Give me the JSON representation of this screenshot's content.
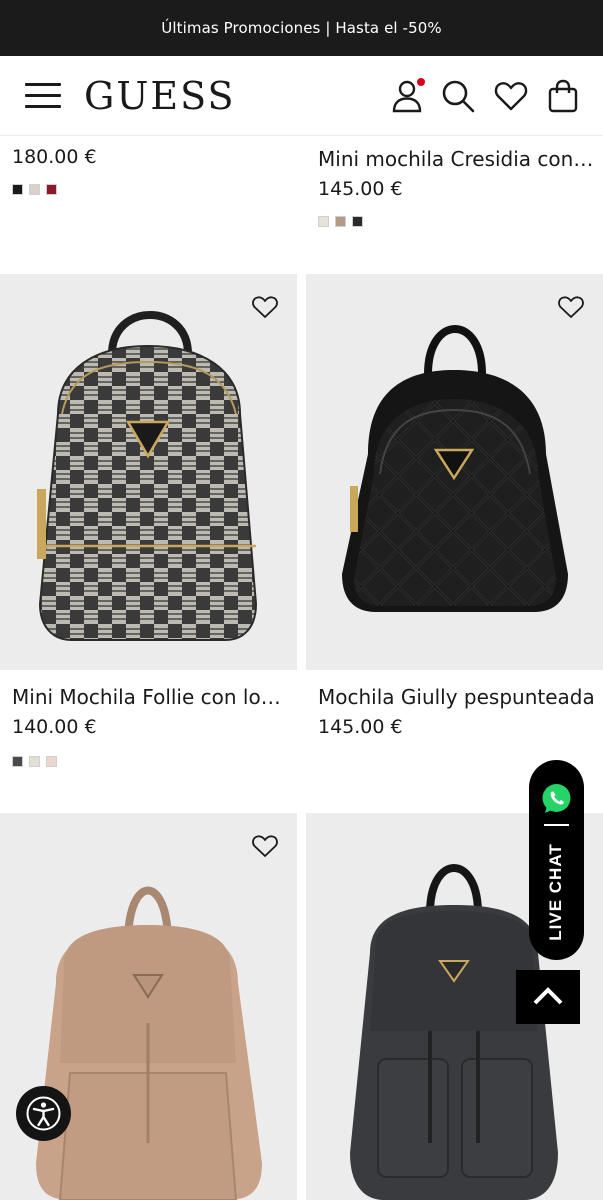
{
  "promo_bar": {
    "text": "Últimas Promociones | Hasta el -50%"
  },
  "header": {
    "logo": "GUESS"
  },
  "products": [
    {
      "name": "",
      "price": "180.00 €",
      "swatches": [
        "#1a1a1a",
        "#d8d2c8",
        "#8b1a2b"
      ]
    },
    {
      "name": "Mini mochila Cresidia con l...",
      "price": "145.00 €",
      "swatches": [
        "#e6e2d6",
        "#b59a86",
        "#2b2b2b"
      ]
    },
    {
      "name": "Mini Mochila Follie con log...",
      "price": "140.00 €",
      "swatches": [
        "#4a4a4a",
        "#e4dfd2",
        "#ead8cc"
      ]
    },
    {
      "name": "Mochila Giully pespunteada",
      "price": "145.00 €",
      "swatches": []
    },
    {
      "name": "",
      "price": "",
      "swatches": []
    },
    {
      "name": "",
      "price": "",
      "swatches": []
    }
  ],
  "live_chat": {
    "label": "LIVE CHAT"
  },
  "colors": {
    "promo_bg": "#1b1b1b",
    "card_bg": "#ececec",
    "notification_dot": "#d6001c",
    "whatsapp": "#25d366"
  },
  "icons": [
    "menu-icon",
    "user-icon",
    "search-icon",
    "heart-icon",
    "shopping-bag-icon",
    "whatsapp-icon",
    "chevron-up-icon",
    "accessibility-icon"
  ]
}
